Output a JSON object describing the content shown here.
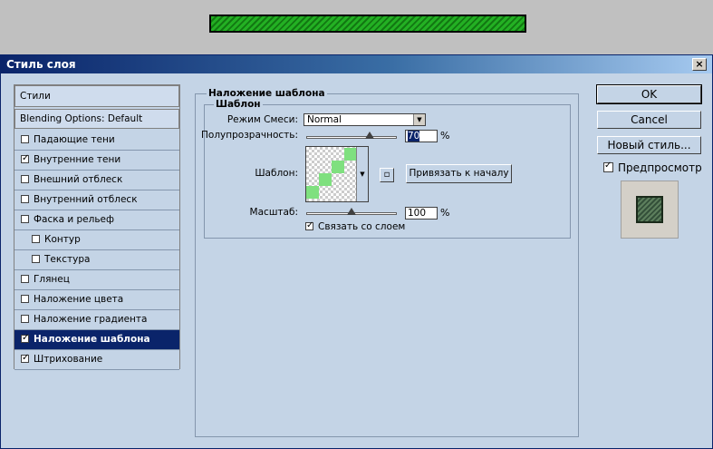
{
  "dialog": {
    "title": "Стиль слоя",
    "close_glyph": "×"
  },
  "style_list": {
    "header": "Стили",
    "blending": "Blending Options: Default",
    "items": [
      {
        "label": "Падающие тени",
        "checked": false,
        "indent": false,
        "selected": false
      },
      {
        "label": "Внутренние тени",
        "checked": true,
        "indent": false,
        "selected": false
      },
      {
        "label": "Внешний отблеск",
        "checked": false,
        "indent": false,
        "selected": false
      },
      {
        "label": "Внутренний отблеск",
        "checked": false,
        "indent": false,
        "selected": false
      },
      {
        "label": "Фаска и рельеф",
        "checked": false,
        "indent": false,
        "selected": false
      },
      {
        "label": "Контур",
        "checked": false,
        "indent": true,
        "selected": false
      },
      {
        "label": "Текстура",
        "checked": false,
        "indent": true,
        "selected": false
      },
      {
        "label": "Глянец",
        "checked": false,
        "indent": false,
        "selected": false
      },
      {
        "label": "Наложение цвета",
        "checked": false,
        "indent": false,
        "selected": false
      },
      {
        "label": "Наложение градиента",
        "checked": false,
        "indent": false,
        "selected": false
      },
      {
        "label": "Наложение шаблона",
        "checked": true,
        "indent": false,
        "selected": true
      },
      {
        "label": "Штрихование",
        "checked": true,
        "indent": false,
        "selected": false
      }
    ]
  },
  "pattern_overlay": {
    "group_title": "Наложение шаблона",
    "subgroup_title": "Шаблон",
    "blend_mode_label": "Режим Смеси:",
    "blend_mode_value": "Normal",
    "opacity_label": "Полупрозрачность:",
    "opacity_value": "70",
    "opacity_unit": "%",
    "opacity_level": 0.7,
    "pattern_label": "Шаблон:",
    "snap_button": "Привязать к началу",
    "new_preset_glyph": "▫",
    "scale_label": "Масштаб:",
    "scale_value": "100",
    "scale_unit": "%",
    "scale_level": 0.5,
    "link_label": "Связать со слоем",
    "link_checked": true
  },
  "actions": {
    "ok": "OK",
    "cancel": "Cancel",
    "new_style": "Новый стиль...",
    "preview_label": "Предпросмотр",
    "preview_checked": true
  },
  "colors": {
    "progress_green": "#1fa01f",
    "pattern_green": "#7fe07f",
    "selection": "#0a246a",
    "dialog_bg": "#c4d4e6"
  }
}
